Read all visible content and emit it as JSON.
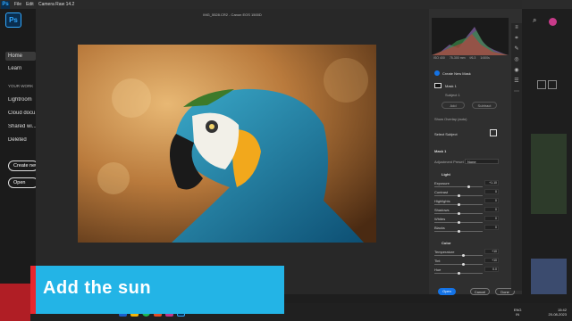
{
  "ps_menu": {
    "file": "File",
    "edit": "Edit"
  },
  "ps_logo": "Ps",
  "sidebar": {
    "home": "Home",
    "learn": "Learn",
    "your_work": "YOUR WORK",
    "lightroom": "Lightroom",
    "cloud_docs": "Cloud docu...",
    "shared": "Shared wi...",
    "deleted": "Deleted",
    "create_new": "Create new",
    "open": "Open"
  },
  "window": {
    "title": "Camera Raw 14.2"
  },
  "file_info": "IMG_5528.CR2 - Canon EOS 1500D",
  "exif": {
    "iso": "ISO 400",
    "lens": "75-300 mm",
    "aperture": "f/6.3",
    "shutter": "1/400s"
  },
  "masks": {
    "create_new_mask": "Create New Mask",
    "mask_name": "Mask 1",
    "subject": "Subject 1",
    "add": "Add",
    "subtract": "Subtract",
    "show_overlay": "Show Overlay (auto)",
    "select_subject": "Select Subject",
    "mask_title": "Mask 1",
    "adjustment_preset": "Adjustment Preset",
    "preset_value": "None"
  },
  "light": {
    "title": "Light",
    "rows": [
      {
        "label": "Exposure",
        "value": "+1.10",
        "pos": 0.72
      },
      {
        "label": "Contrast",
        "value": "0",
        "pos": 0.5
      },
      {
        "label": "Highlights",
        "value": "0",
        "pos": 0.5
      },
      {
        "label": "Shadows",
        "value": "0",
        "pos": 0.5
      },
      {
        "label": "Whites",
        "value": "0",
        "pos": 0.5
      },
      {
        "label": "Blacks",
        "value": "0",
        "pos": 0.5
      }
    ]
  },
  "color": {
    "title": "Color",
    "rows": [
      {
        "label": "Temperature",
        "value": "+10",
        "pos": 0.6
      },
      {
        "label": "Tint",
        "value": "+10",
        "pos": 0.6
      },
      {
        "label": "Hue",
        "value": "0.0",
        "pos": 0.5
      }
    ]
  },
  "footer": {
    "open": "Open",
    "cancel": "Cancel",
    "done": "Done"
  },
  "taskbar": {
    "lang": "ENG",
    "region": "IN",
    "time": "15:42",
    "date": "20-08-2023"
  },
  "banner": {
    "text": "Add the sun"
  },
  "colors": {
    "banner_bg": "#23b4e6",
    "banner_accent": "#e8282f",
    "ps_blue": "#31a8ff",
    "cr_accent": "#1473e6"
  }
}
